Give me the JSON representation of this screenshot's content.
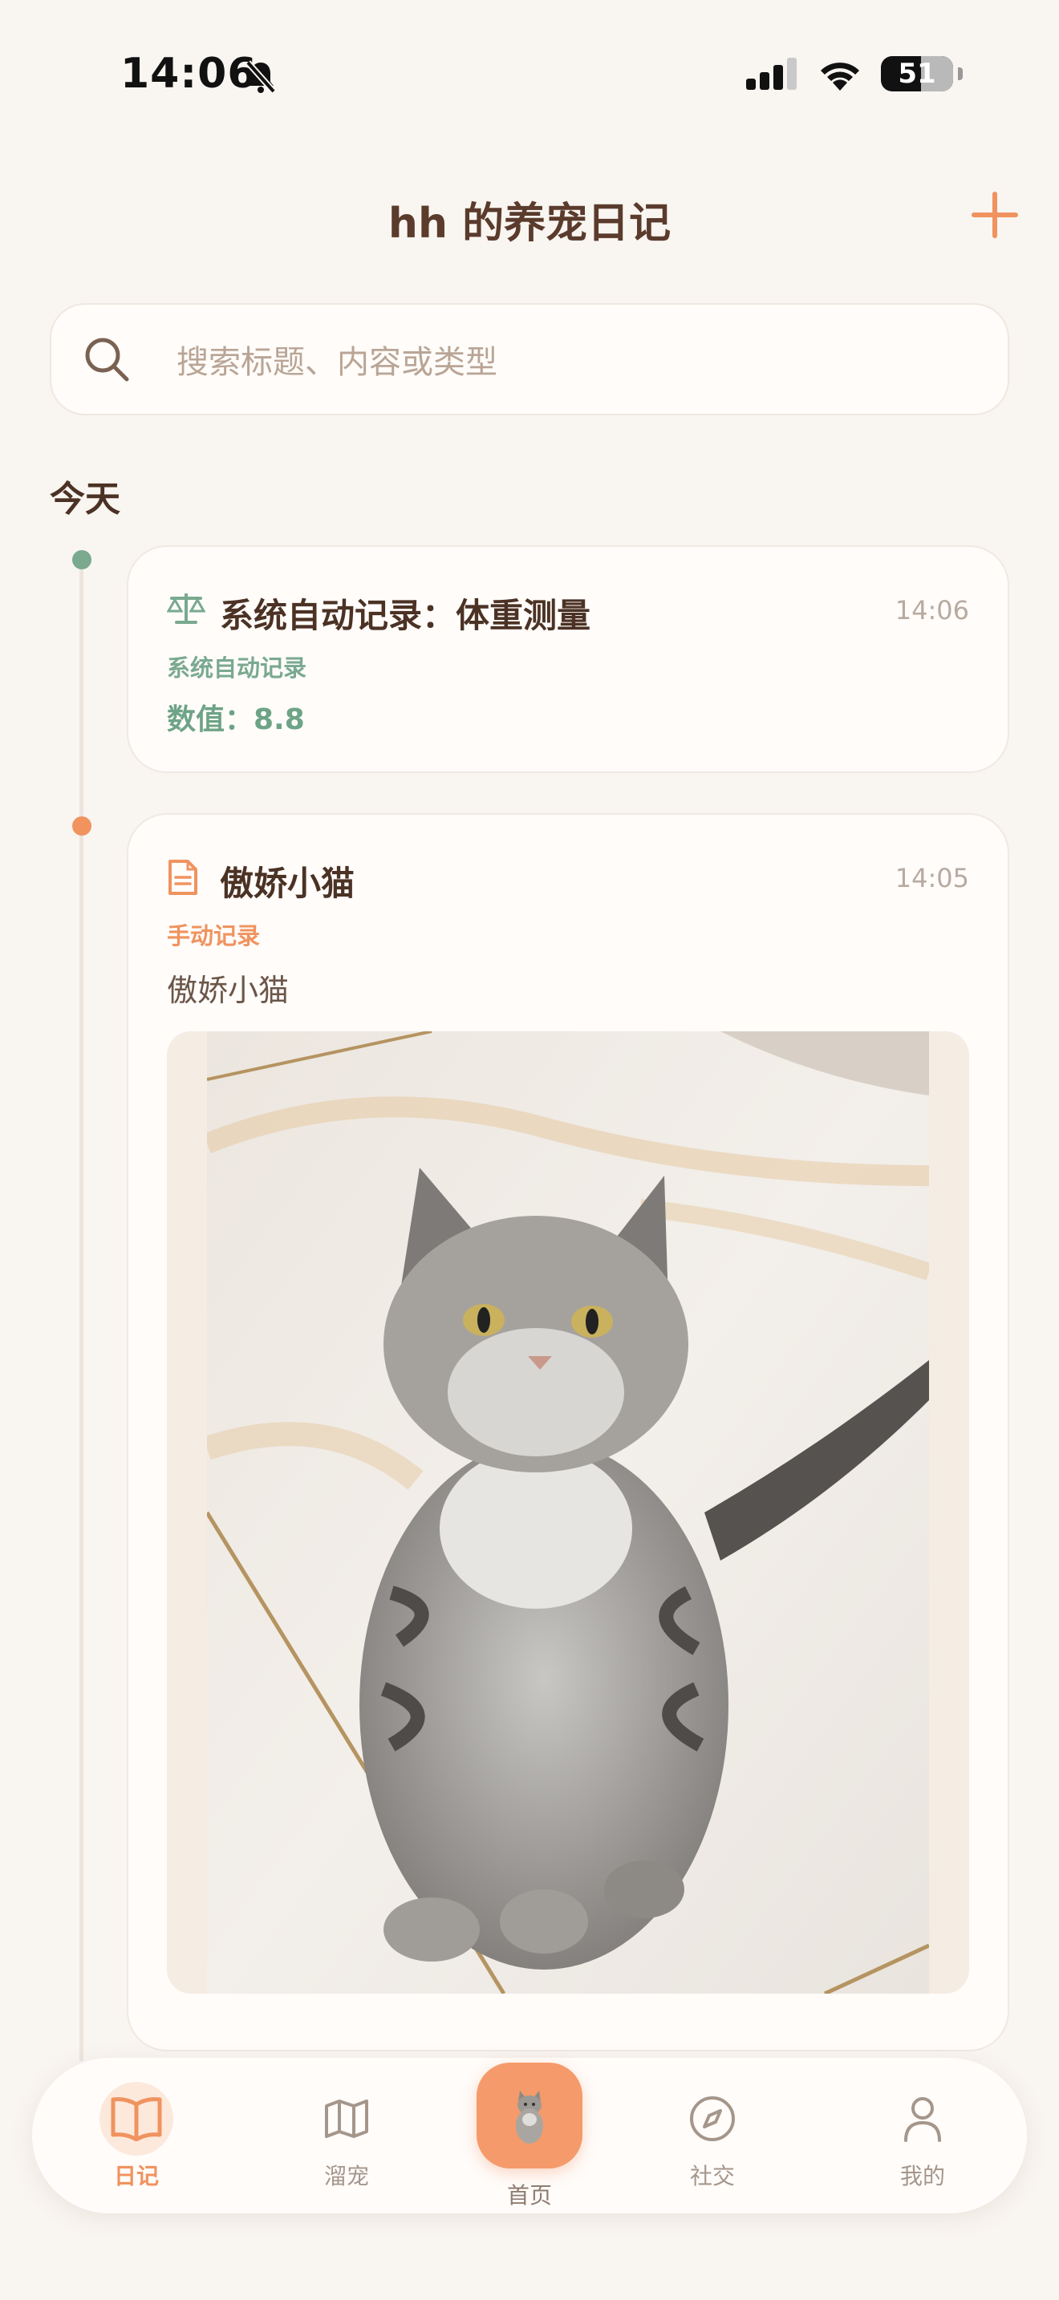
{
  "status_bar": {
    "time": "14:06",
    "battery": "51"
  },
  "header": {
    "title": "hh 的养宠日记"
  },
  "search": {
    "placeholder": "搜索标题、内容或类型"
  },
  "section": {
    "label": "今天"
  },
  "entries": [
    {
      "icon": "scale-icon",
      "title": "系统自动记录：体重测量",
      "time": "14:06",
      "tag": "系统自动记录",
      "value": "数值：8.8"
    },
    {
      "icon": "document-icon",
      "title": "傲娇小猫",
      "time": "14:05",
      "tag": "手动记录",
      "body": "傲娇小猫"
    }
  ],
  "nav": {
    "items": [
      {
        "label": "日记",
        "icon": "book-icon"
      },
      {
        "label": "溜宠",
        "icon": "map-icon"
      },
      {
        "label": "首页",
        "icon": "cat-icon"
      },
      {
        "label": "社交",
        "icon": "compass-icon"
      },
      {
        "label": "我的",
        "icon": "user-icon"
      }
    ]
  },
  "colors": {
    "accent": "#f0935f",
    "green": "#7aa98f",
    "background": "#f9f5f1",
    "text": "#5a3b2c"
  }
}
